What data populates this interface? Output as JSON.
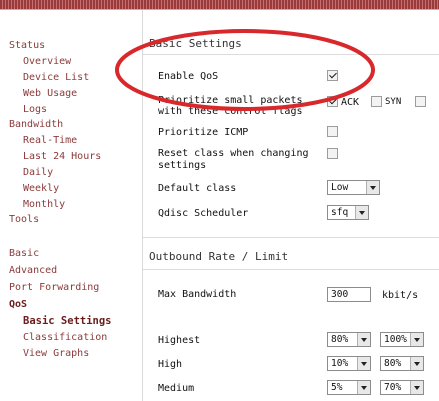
{
  "sidebar": {
    "items": [
      {
        "label": "Status"
      },
      {
        "label": "Overview"
      },
      {
        "label": "Device List"
      },
      {
        "label": "Web Usage"
      },
      {
        "label": "Logs"
      },
      {
        "label": "Bandwidth"
      },
      {
        "label": "Real-Time"
      },
      {
        "label": "Last 24 Hours"
      },
      {
        "label": "Daily"
      },
      {
        "label": "Weekly"
      },
      {
        "label": "Monthly"
      },
      {
        "label": "Tools"
      },
      {
        "label": "Basic"
      },
      {
        "label": "Advanced"
      },
      {
        "label": "Port Forwarding"
      },
      {
        "label": "QoS"
      },
      {
        "label": "Basic Settings"
      },
      {
        "label": "Classification"
      },
      {
        "label": "View Graphs"
      }
    ]
  },
  "basic_settings": {
    "title": "Basic Settings",
    "enable_qos": {
      "label": "Enable QoS",
      "checked": true
    },
    "prioritize_small": {
      "label_line1": "Prioritize small packets",
      "label_line2": "with these control flags",
      "flags": [
        {
          "label": "ACK",
          "checked": true
        },
        {
          "label": "SYN",
          "checked": false
        },
        {
          "label": "",
          "checked": false
        }
      ]
    },
    "prioritize_icmp": {
      "label": "Prioritize ICMP",
      "checked": false
    },
    "reset_class": {
      "label_line1": "Reset class when changing",
      "label_line2": "settings",
      "checked": false
    },
    "default_class": {
      "label": "Default class",
      "value": "Low"
    },
    "qdisc": {
      "label": "Qdisc Scheduler",
      "value": "sfq"
    }
  },
  "outbound": {
    "title": "Outbound Rate / Limit",
    "max_bandwidth": {
      "label": "Max Bandwidth",
      "value": "300",
      "unit": "kbit/s"
    },
    "classes": [
      {
        "label": "Highest",
        "min": "80%",
        "max": "100%"
      },
      {
        "label": "High",
        "min": "10%",
        "max": "80%"
      },
      {
        "label": "Medium",
        "min": "5%",
        "max": "70%"
      }
    ]
  },
  "colors": {
    "nav_link": "#8b3a3a",
    "nav_active": "#6b1c1c",
    "annotation_ellipse": "#d8282b",
    "top_border": "#9a3b3b"
  }
}
